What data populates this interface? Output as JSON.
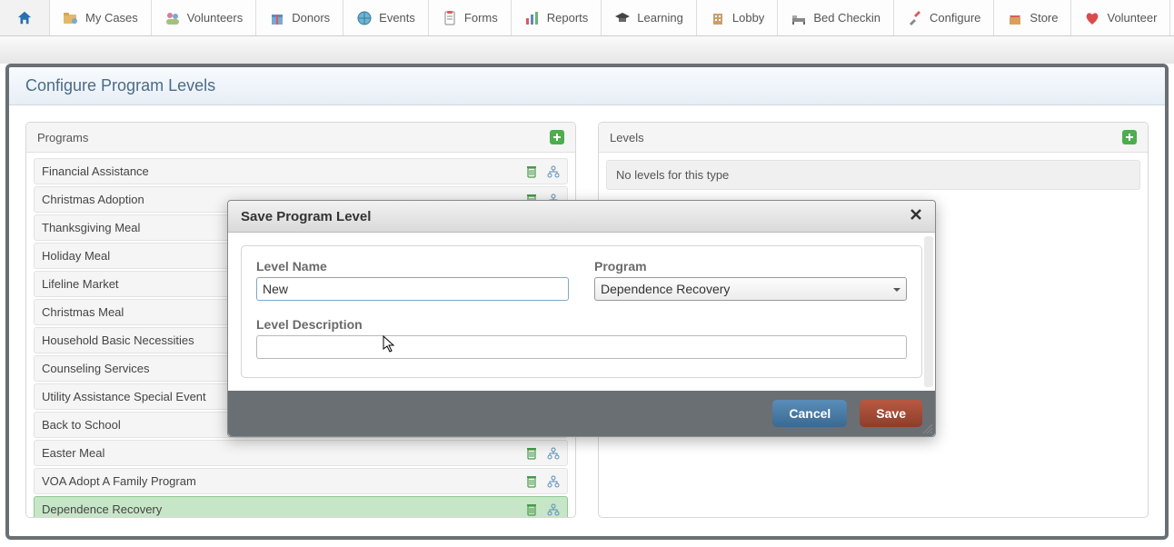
{
  "nav": {
    "items": [
      {
        "label": "My Cases",
        "icon": "folder-person"
      },
      {
        "label": "Volunteers",
        "icon": "people"
      },
      {
        "label": "Donors",
        "icon": "gift"
      },
      {
        "label": "Events",
        "icon": "globe"
      },
      {
        "label": "Forms",
        "icon": "clipboard"
      },
      {
        "label": "Reports",
        "icon": "bar-chart"
      },
      {
        "label": "Learning",
        "icon": "grad-cap"
      },
      {
        "label": "Lobby",
        "icon": "building"
      },
      {
        "label": "Bed Checkin",
        "icon": "bed"
      },
      {
        "label": "Configure",
        "icon": "tools"
      },
      {
        "label": "Store",
        "icon": "store"
      },
      {
        "label": "Volunteer",
        "icon": "heart"
      }
    ]
  },
  "page": {
    "title": "Configure Program Levels"
  },
  "programs": {
    "header": "Programs",
    "items": [
      {
        "name": "Financial Assistance"
      },
      {
        "name": "Christmas Adoption"
      },
      {
        "name": "Thanksgiving Meal"
      },
      {
        "name": "Holiday Meal"
      },
      {
        "name": "Lifeline Market"
      },
      {
        "name": "Christmas Meal"
      },
      {
        "name": "Household Basic Necessities"
      },
      {
        "name": "Counseling Services"
      },
      {
        "name": "Utility Assistance Special Event"
      },
      {
        "name": "Back to School"
      },
      {
        "name": "Easter Meal"
      },
      {
        "name": "VOA Adopt A Family Program"
      },
      {
        "name": "Dependence Recovery",
        "selected": true
      }
    ]
  },
  "levels": {
    "header": "Levels",
    "empty": "No levels for this type"
  },
  "modal": {
    "title": "Save Program Level",
    "level_name_label": "Level Name",
    "level_name_value": "New",
    "program_label": "Program",
    "program_value": "Dependence Recovery",
    "description_label": "Level Description",
    "description_value": "",
    "cancel": "Cancel",
    "save": "Save"
  }
}
